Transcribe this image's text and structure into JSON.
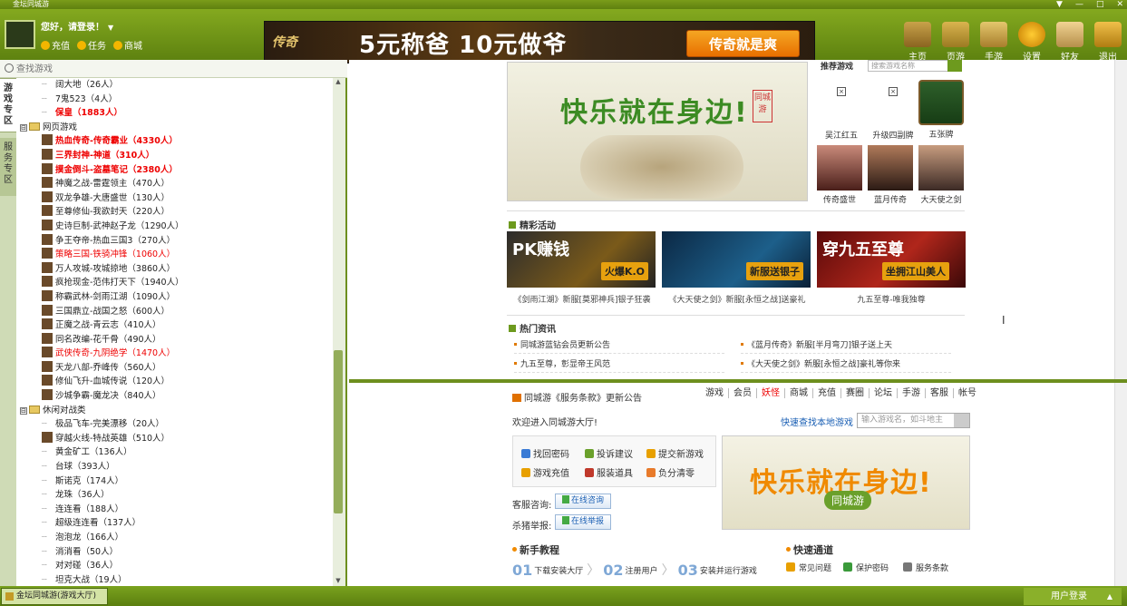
{
  "window": {
    "title": "金坛同城游",
    "controls": [
      "▼",
      "—",
      "□",
      "✕"
    ]
  },
  "header": {
    "greeting": "您好，请登录！",
    "links": [
      {
        "label": "充值"
      },
      {
        "label": "任务"
      },
      {
        "label": "商城"
      }
    ],
    "banner": {
      "logo": "传奇",
      "slogan": "5元称爸 10元做爷",
      "button": "传奇就是爽"
    },
    "toolbar": [
      {
        "label": "主页",
        "icon": "home-icon"
      },
      {
        "label": "页游",
        "icon": "webgame-icon"
      },
      {
        "label": "手游",
        "icon": "mobilegame-icon"
      },
      {
        "label": "设置",
        "icon": "settings-icon"
      },
      {
        "label": "好友",
        "icon": "friends-icon"
      },
      {
        "label": "退出",
        "icon": "exit-icon"
      }
    ]
  },
  "sidebar": {
    "search_placeholder": "查找游戏",
    "tabs": [
      {
        "label": "游戏专区",
        "active": true
      },
      {
        "label": "服务专区",
        "active": false
      }
    ],
    "tree": [
      {
        "type": "game",
        "label": "阔大地（26人）",
        "style": "plain"
      },
      {
        "type": "game",
        "label": "7鬼523（4人）",
        "style": "plain"
      },
      {
        "type": "game",
        "label": "保皇（1883人）",
        "style": "hot"
      },
      {
        "type": "cat",
        "label": "网页游戏",
        "toggle": "⊟"
      },
      {
        "type": "game",
        "label": "热血传奇-传奇霸业（4330人）",
        "style": "hot",
        "icon": true
      },
      {
        "type": "game",
        "label": "三界封神-神道（310人）",
        "style": "hot",
        "icon": true
      },
      {
        "type": "game",
        "label": "摸金倒斗-盗墓笔记（2380人）",
        "style": "hot",
        "icon": true
      },
      {
        "type": "game",
        "label": "神魔之战-雷霆领主（470人）",
        "style": "plain",
        "icon": true
      },
      {
        "type": "game",
        "label": "双龙争雄-大唐盛世（130人）",
        "style": "plain",
        "icon": true
      },
      {
        "type": "game",
        "label": "至尊修仙-我欲封天（220人）",
        "style": "plain",
        "icon": true
      },
      {
        "type": "game",
        "label": "史诗巨制-武神赵子龙（1290人）",
        "style": "plain",
        "icon": true
      },
      {
        "type": "game",
        "label": "争王夺帝-热血三国3（270人）",
        "style": "plain",
        "icon": true
      },
      {
        "type": "game",
        "label": "策略三国-铁骑冲锋（1060人）",
        "style": "red",
        "icon": true
      },
      {
        "type": "game",
        "label": "万人攻城-攻城掠地（3860人）",
        "style": "plain",
        "icon": true
      },
      {
        "type": "game",
        "label": "疯抢现金-范伟打天下（1940人）",
        "style": "plain",
        "icon": true
      },
      {
        "type": "game",
        "label": "称霸武林-剑雨江湖（1090人）",
        "style": "plain",
        "icon": true
      },
      {
        "type": "game",
        "label": "三国鼎立-战国之怒（600人）",
        "style": "plain",
        "icon": true
      },
      {
        "type": "game",
        "label": "正魔之战-青云志（410人）",
        "style": "plain",
        "icon": true
      },
      {
        "type": "game",
        "label": "同名改编-花千骨（490人）",
        "style": "plain",
        "icon": true
      },
      {
        "type": "game",
        "label": "武侠传奇-九阴绝学（1470人）",
        "style": "red",
        "icon": true
      },
      {
        "type": "game",
        "label": "天龙八部-乔峰传（560人）",
        "style": "plain",
        "icon": true
      },
      {
        "type": "game",
        "label": "修仙飞升-血城传说（120人）",
        "style": "plain",
        "icon": true
      },
      {
        "type": "game",
        "label": "沙城争霸-魔龙决（840人）",
        "style": "plain",
        "icon": true
      },
      {
        "type": "cat",
        "label": "休闲对战类",
        "toggle": "⊟"
      },
      {
        "type": "game",
        "label": "极品飞车-完美漂移（20人）",
        "style": "plain"
      },
      {
        "type": "game",
        "label": "穿越火线-特战英雄（510人）",
        "style": "plain",
        "icon": true
      },
      {
        "type": "game",
        "label": "黄金矿工（136人）",
        "style": "plain"
      },
      {
        "type": "game",
        "label": "台球（393人）",
        "style": "plain"
      },
      {
        "type": "game",
        "label": "斯诺克（174人）",
        "style": "plain"
      },
      {
        "type": "game",
        "label": "龙珠（36人）",
        "style": "plain"
      },
      {
        "type": "game",
        "label": "连连看（188人）",
        "style": "plain"
      },
      {
        "type": "game",
        "label": "超级连连看（137人）",
        "style": "plain"
      },
      {
        "type": "game",
        "label": "泡泡龙（166人）",
        "style": "plain"
      },
      {
        "type": "game",
        "label": "消消看（50人）",
        "style": "plain"
      },
      {
        "type": "game",
        "label": "对对碰（36人）",
        "style": "plain"
      },
      {
        "type": "game",
        "label": "坦克大战（19人）",
        "style": "plain"
      }
    ]
  },
  "portal": {
    "hero": {
      "text": "快乐就在身边!",
      "tag": "同城游"
    },
    "recommend": {
      "label": "推荐游戏",
      "search_placeholder": "搜索游戏名称",
      "games": [
        "吴江红五",
        "升级四副牌",
        "五张牌",
        "传奇盛世",
        "蓝月传奇",
        "大天使之剑"
      ]
    },
    "activities": {
      "title": "精彩活动",
      "items": [
        {
          "caption": "《剑雨江湖》新服[莫邪神兵]银子狂袭",
          "banner_title": "PK赚钱",
          "badge": "火爆K.O"
        },
        {
          "caption": "《大天使之剑》新服[永恒之战]送豪礼",
          "banner_title": "",
          "badge": "新服送银子"
        },
        {
          "caption": "九五至尊-唯我独尊",
          "banner_title": "穿九五至尊",
          "badge": "坐拥江山美人"
        }
      ]
    },
    "news": {
      "title": "热门资讯",
      "items": [
        "同城游蓝钻会员更新公告",
        "《蓝月传奇》新服[半月弯刀]银子送上天",
        "九五至尊，彰显帝王风范",
        "《大天使之剑》新服[永恒之战]豪礼等你来"
      ]
    },
    "lower": {
      "notice": "同城游《服务条款》更新公告",
      "nav": [
        "游戏",
        "会员",
        "妖怪",
        "商城",
        "充值",
        "赛圈",
        "论坛",
        "手游",
        "客服",
        "帐号"
      ],
      "welcome": "欢迎进入同城游大厅!",
      "quick_find": "快速查找本地游戏",
      "game_search_placeholder": "输入游戏名，如斗地主",
      "services": [
        "找回密码",
        "投诉建议",
        "提交新游戏",
        "游戏充值",
        "服装道具",
        "负分清零"
      ],
      "consult_label": "客服咨询:",
      "consult_btn": "在线咨询",
      "report_label": "杀猪举报:",
      "report_btn": "在线举报",
      "promo_text": "快乐就在身边!",
      "promo_brand": "同城游",
      "tutorial_title": "新手教程",
      "steps": [
        {
          "n": "01",
          "label": "下载安装大厅"
        },
        {
          "n": "02",
          "label": "注册用户"
        },
        {
          "n": "03",
          "label": "安装并运行游戏"
        }
      ],
      "quick_title": "快速通道",
      "quick_links": [
        "常见问题",
        "保护密码",
        "服务条款"
      ]
    }
  },
  "statusbar": {
    "task": "金坛同城游(游戏大厅)",
    "login": "用户登录"
  }
}
